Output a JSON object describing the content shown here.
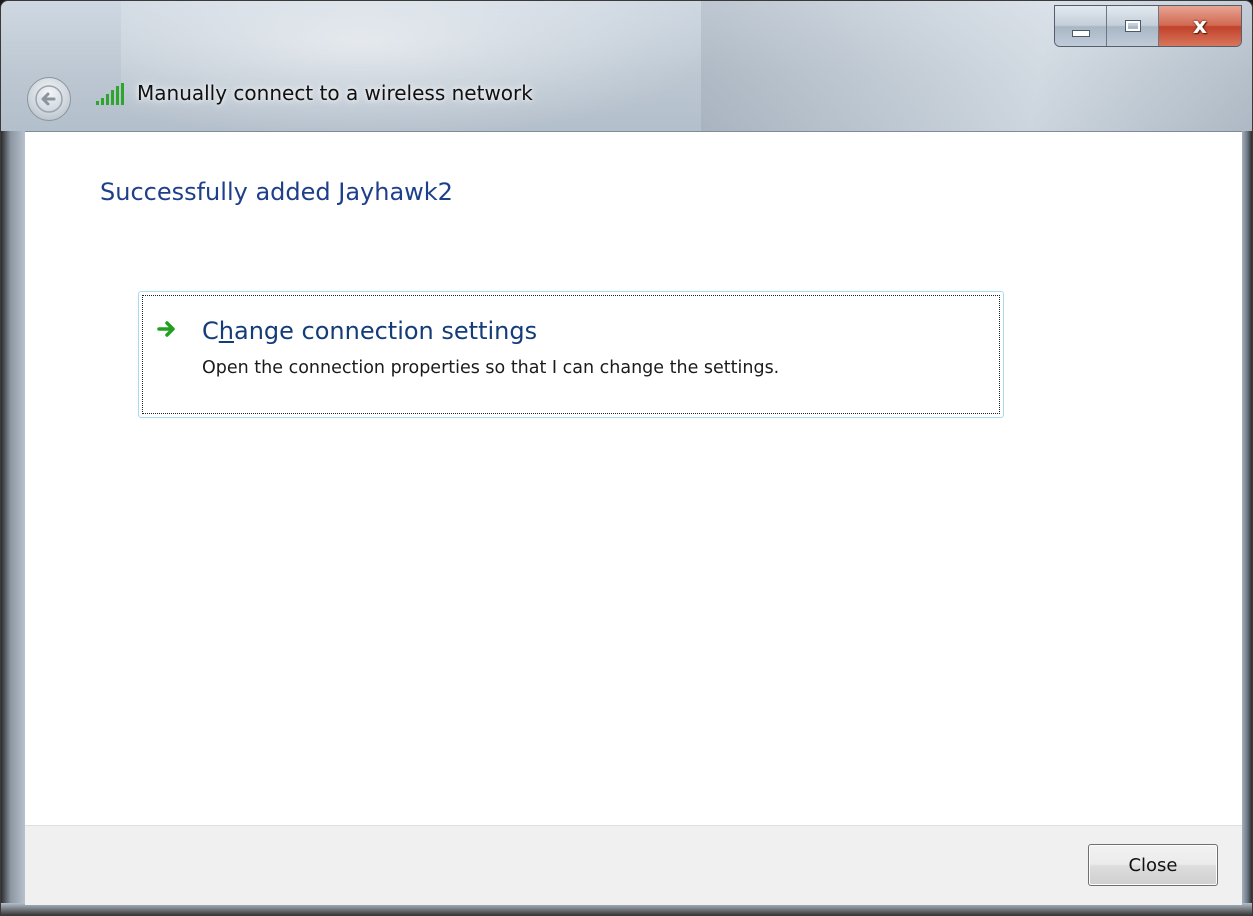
{
  "window": {
    "title": "Manually connect to a wireless network"
  },
  "caption": {
    "close_glyph": "x"
  },
  "content": {
    "heading": "Successfully added Jayhawk2",
    "command_link": {
      "title": "Change connection settings",
      "access_key": "h",
      "description": "Open the connection properties so that I can change the settings."
    }
  },
  "footer": {
    "close_label": "Close"
  },
  "icons": {
    "back": "back-arrow-icon",
    "signal": "wireless-signal-icon",
    "command": "green-arrow-icon"
  },
  "colors": {
    "heading": "#1e3f8a",
    "link_title": "#143c7a",
    "arrow": "#1fa11f",
    "signal": "#2ea52e",
    "close_button_red": "#c1412a"
  }
}
